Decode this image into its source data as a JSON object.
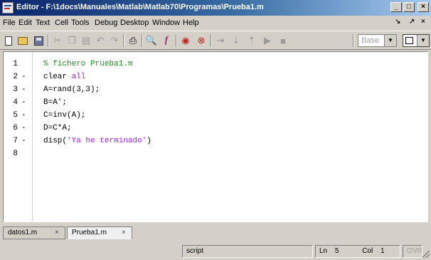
{
  "window": {
    "title": "Editor - F:\\1docs\\Manuales\\Matlab\\Matlab70\\Programas\\Prueba1.m",
    "minimize": "_",
    "maximize": "□",
    "close": "×"
  },
  "menubar": {
    "items": [
      "File",
      "Edit",
      "Text",
      "Cell",
      "Tools",
      "Debug",
      "Desktop",
      "Window",
      "Help"
    ],
    "undock": "↘",
    "dock": "↗",
    "close": "×"
  },
  "toolbar": {
    "buttons": [
      "new-file",
      "open-folder",
      "save",
      "cut",
      "copy",
      "paste",
      "undo",
      "redo",
      "print",
      "find",
      "function",
      "breakpoint-set",
      "breakpoint-clear",
      "step",
      "step-in",
      "step-out",
      "continue",
      "exit-debug"
    ],
    "function_glyph": "f",
    "base_select": {
      "value": "Base"
    }
  },
  "editor": {
    "lines": [
      {
        "num": "1",
        "dash": "",
        "code": "% fichero Prueba1.m"
      },
      {
        "num": "2",
        "dash": "-",
        "code": "clear all"
      },
      {
        "num": "3",
        "dash": "-",
        "code": "A=rand(3,3);"
      },
      {
        "num": "4",
        "dash": "-",
        "code": "B=A';"
      },
      {
        "num": "5",
        "dash": "-",
        "code": "C=inv(A);"
      },
      {
        "num": "6",
        "dash": "-",
        "code": "D=C*A;"
      },
      {
        "num": "7",
        "dash": "-",
        "code": "disp('Ya he terminado')"
      },
      {
        "num": "8",
        "dash": "",
        "code": ""
      }
    ],
    "tokens": {
      "clear": "clear ",
      "all": "all",
      "disp_open": "disp(",
      "disp_str": "'Ya he terminado'",
      "disp_close": ")"
    }
  },
  "tabs": [
    {
      "label": "datos1.m",
      "close": "×"
    },
    {
      "label": "Prueba1.m",
      "close": "×"
    }
  ],
  "statusbar": {
    "mode": "script",
    "ln_label": "Ln",
    "ln_value": "5",
    "col_label": "Col",
    "col_value": "1",
    "ovr": "OVR"
  }
}
